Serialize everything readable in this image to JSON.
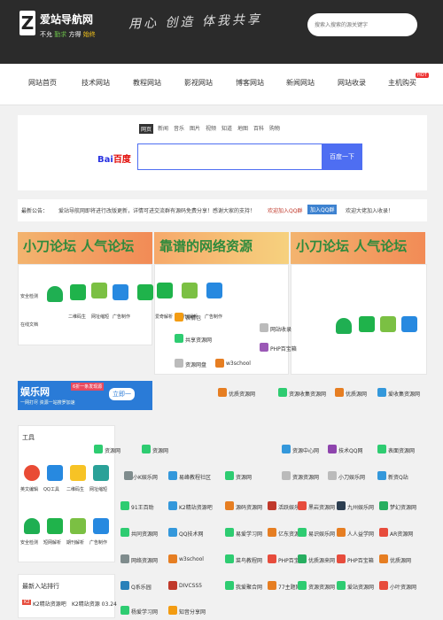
{
  "header": {
    "logo_letter": "Z",
    "site_name": "爱站导航网",
    "tagline_1": "不允",
    "tagline_2": "勤求",
    "tagline_3": "方得",
    "tagline_4": "始终",
    "slogan": "用心  创造 体我共享",
    "search_placeholder": "搜索入搜索的源关键字"
  },
  "nav": {
    "items": [
      "网站首页",
      "技术网站",
      "教程网站",
      "影视网站",
      "博客网站",
      "新闻网站",
      "网站收录",
      "主机购买"
    ],
    "hot_badge": "HOT"
  },
  "search": {
    "tabs": [
      "网页",
      "新闻",
      "音乐",
      "图片",
      "视频",
      "知道",
      "地图",
      "百科",
      "购物"
    ],
    "engine_logo_a": "Bai",
    "engine_logo_b": "百度",
    "button_label": "百度一下"
  },
  "notice": {
    "label": "最新公告：",
    "text": "爱站导航网即将进行改版更新，详情可进交流群有源码免费分享！感谢大家的支持！",
    "link": "欢迎加入QQ群",
    "qq_button": "加入QQ群",
    "right_text": "欢迎大佬加入收录！"
  },
  "banners": [
    "小刀论坛  人气论坛",
    "靠谱的网络资源",
    "小刀论坛  人气论坛"
  ],
  "left_card": {
    "icons": [
      {
        "icon": "shield-icon",
        "label": "安全检测",
        "color": "#1faf52"
      },
      {
        "icon": "iqiyi-icon",
        "label": "",
        "color": "#1fb34b"
      },
      {
        "icon": "game-icon",
        "label": "",
        "color": "#7bc043"
      },
      {
        "icon": "q-icon",
        "label": "",
        "color": "#2789e0"
      },
      {
        "icon": "iqiyi-icon",
        "label": "",
        "color": "#1fb34b"
      },
      {
        "icon": "game-icon",
        "label": "",
        "color": "#7bc043"
      },
      {
        "icon": "q-icon",
        "label": "",
        "color": "#2789e0"
      }
    ],
    "row_labels": [
      "二维码生",
      "网址缩短",
      "广告制作",
      "爱奇解析",
      "期刊解析",
      "广告制作"
    ],
    "bottom_label": "在线文档"
  },
  "middle_card": {
    "items": [
      "表情包",
      "共享资源网",
      "资源网盘",
      "w3school"
    ]
  },
  "right_card": {
    "items": [
      "网站收录",
      "PHP百宝箱"
    ]
  },
  "yule": {
    "title": "娱乐网",
    "pill": "6折一条发现源",
    "subtitle": "一网打尽  资源一站搜罗加速",
    "button": "立即一"
  },
  "tools_card": {
    "title": "工具",
    "row1": [
      {
        "icon": "red-circle-icon",
        "label": "英文编辑",
        "color": "#e94b35"
      },
      {
        "icon": "z-icon",
        "label": "QQ工具",
        "color": "#2789e0"
      },
      {
        "icon": "qrcode-icon",
        "label": "二维码生",
        "color": "#f7c325"
      },
      {
        "icon": "link-icon",
        "label": "网址缩短",
        "color": "#2aa198"
      }
    ],
    "row2": [
      {
        "icon": "shield-icon",
        "label": "安全检测",
        "color": "#1faf52"
      },
      {
        "icon": "iqiyi-icon",
        "label": "短网解析",
        "color": "#1fb34b"
      },
      {
        "icon": "game-icon",
        "label": "期刊解析",
        "color": "#7bc043"
      },
      {
        "icon": "q-icon",
        "label": "广告制作",
        "color": "#2789e0"
      }
    ]
  },
  "rank": {
    "title": "最新入站排行",
    "tag1": "K2",
    "item1": "K2精站资源吧",
    "item2": "K2精站资源 03.24"
  },
  "links_grid": [
    [
      "优质资源网",
      "资源收集资源网",
      "优质源网",
      "爱收集资源网",
      "资源源站网"
    ],
    [
      "资源网",
      "资源网",
      "资源中心网",
      "技术QQ网",
      "表面资源网"
    ],
    [
      "小K娱乐网",
      "易峰教程社区",
      "资源网",
      "资源资源网",
      "小刀娱乐网",
      "新资Q站"
    ],
    [
      "91王百助",
      "K2精站资源吧",
      "源码资源网",
      "活跃娱乐网",
      "黑岩资源网",
      "九州娱乐网",
      "梦幻资源网"
    ],
    [
      "共同资源网",
      "QQ技术网",
      "易爱学习网",
      "亿东资源网",
      "易识娱乐网",
      "人人益学网",
      "AR资源网"
    ],
    [
      "网络资源网",
      "w3school",
      "菜鸟教程网",
      "PHP百宝箱",
      "优质源来网",
      "PHP百宝箱",
      "优质源网"
    ],
    [
      "Q系乐园",
      "DIVCSS5",
      "我爱聚合网",
      "77主题网",
      "资源资源网",
      "爱站资源网",
      "小叶资源网"
    ],
    [
      "杨爱学习网",
      "知音分享网",
      "",
      "",
      "",
      "",
      ""
    ]
  ]
}
